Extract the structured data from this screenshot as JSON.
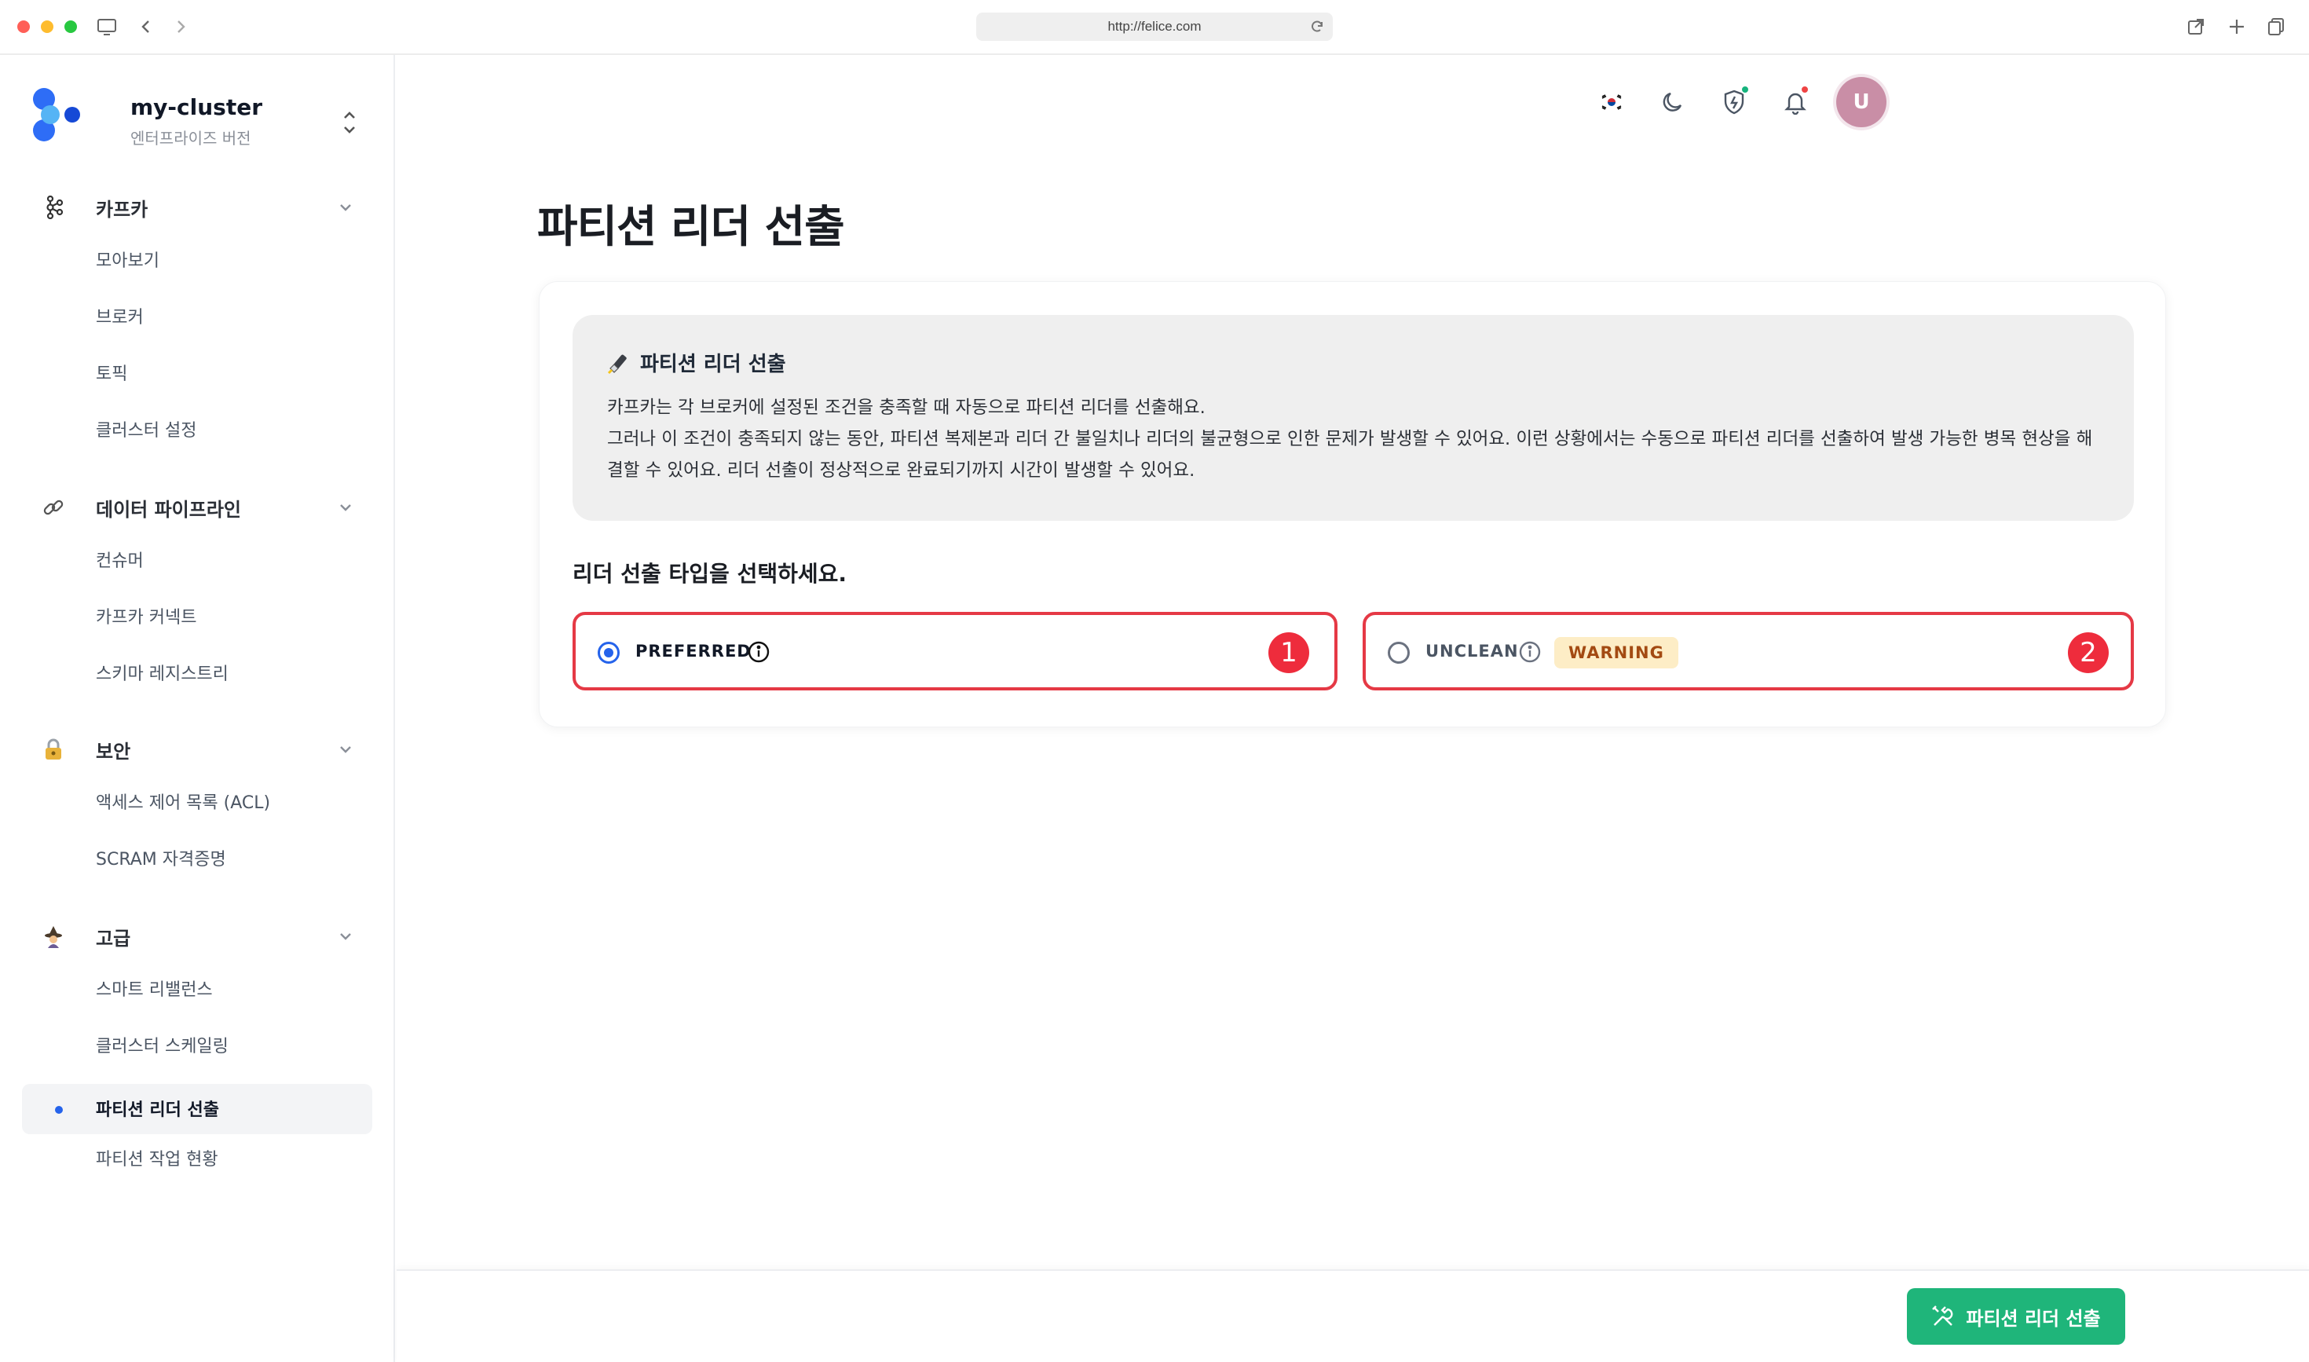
{
  "browser": {
    "url": "http://felice.com"
  },
  "sidebar": {
    "cluster_name": "my-cluster",
    "edition": "엔터프라이즈 버전",
    "groups": [
      {
        "label": "카프카",
        "icon": "kafka-icon",
        "items": [
          "모아보기",
          "브로커",
          "토픽",
          "클러스터 설정"
        ]
      },
      {
        "label": "데이터 파이프라인",
        "icon": "link-icon",
        "items": [
          "컨슈머",
          "카프카 커넥트",
          "스키마 레지스트리"
        ]
      },
      {
        "label": "보안",
        "icon": "lock-icon",
        "items": [
          "액세스 제어 목록 (ACL)",
          "SCRAM 자격증명"
        ]
      },
      {
        "label": "고급",
        "icon": "wizard-icon",
        "items": [
          "스마트 리밸런스",
          "클러스터 스케일링",
          "파티션 리더 선출",
          "파티션 작업 현황"
        ]
      }
    ],
    "active_item": "파티션 리더 선출"
  },
  "header": {
    "flag_icon": "korea-flag-icon",
    "theme_icon": "moon-icon",
    "security_icon": "shield-icon",
    "notification_icon": "bell-icon",
    "avatar_initial": "U",
    "colors": {
      "security_dot": "#16b37d",
      "notification_dot": "#ef4444"
    }
  },
  "main": {
    "title": "파티션 리더 선출",
    "info": {
      "title": "파티션 리더 선출",
      "line1": "카프카는 각 브로커에 설정된 조건을 충족할 때 자동으로 파티션 리더를 선출해요.",
      "line2": "그러나 이 조건이 충족되지 않는 동안, 파티션 복제본과 리더 간 불일치나 리더의 불균형으로 인한 문제가 발생할 수 있어요. 이런 상황에서는 수동으로 파티션 리더를 선출하여 발생 가능한 병목 현상을 해결할 수 있어요. 리더 선출이 정상적으로 완료되기까지 시간이 발생할 수 있어요."
    },
    "select_label": "리더 선출 타입을 선택하세요.",
    "options": [
      {
        "label": "PREFERRED",
        "selected": true,
        "marker": "1"
      },
      {
        "label": "UNCLEAN",
        "selected": false,
        "badge": "WARNING",
        "marker": "2"
      }
    ]
  },
  "footer": {
    "submit_label": "파티션 리더 선출",
    "colors": {
      "submit_bg": "#1fb57a"
    }
  }
}
